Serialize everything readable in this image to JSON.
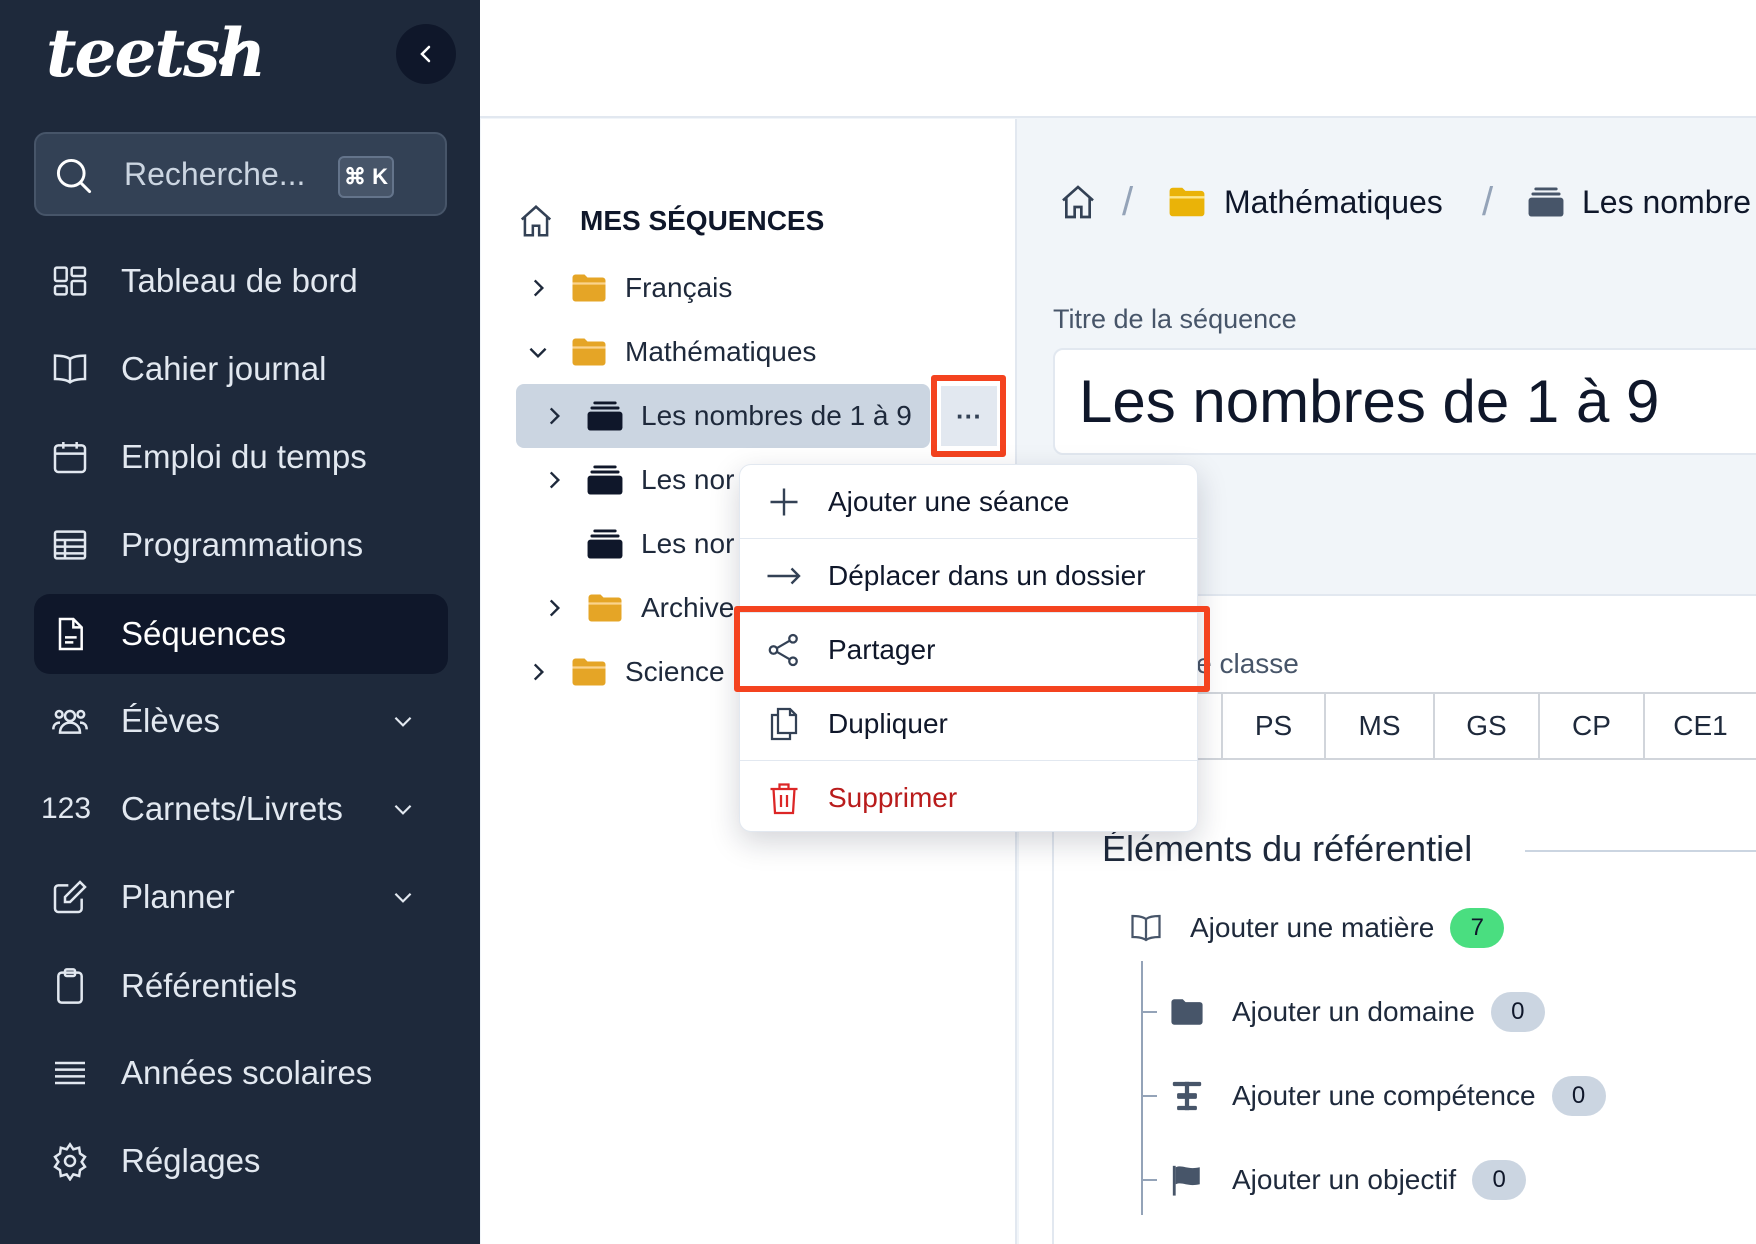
{
  "sidebar": {
    "logo": "teetsh",
    "search": {
      "placeholder": "Recherche...",
      "shortcut": "⌘ K"
    },
    "items": [
      {
        "label": "Tableau de bord",
        "icon": "dashboard-icon"
      },
      {
        "label": "Cahier journal",
        "icon": "book-icon"
      },
      {
        "label": "Emploi du temps",
        "icon": "calendar-icon"
      },
      {
        "label": "Programmations",
        "icon": "table-icon"
      },
      {
        "label": "Séquences",
        "icon": "document-icon",
        "active": true
      },
      {
        "label": "Élèves",
        "icon": "users-icon",
        "expandable": true
      },
      {
        "label": "Carnets/Livrets",
        "icon": "numbers-icon",
        "icon_text": "123",
        "expandable": true
      },
      {
        "label": "Planner",
        "icon": "pencil-icon",
        "expandable": true
      },
      {
        "label": "Référentiels",
        "icon": "clipboard-icon"
      },
      {
        "label": "Années scolaires",
        "icon": "list-icon"
      },
      {
        "label": "Réglages",
        "icon": "gear-icon"
      }
    ]
  },
  "tree": {
    "header": "MES SÉQUENCES",
    "items": [
      {
        "label": "Français",
        "type": "folder"
      },
      {
        "label": "Mathématiques",
        "type": "folder",
        "expanded": true
      },
      {
        "label": "Les nombres de 1 à 9",
        "type": "sequence",
        "selected": true
      },
      {
        "label": "Les nor",
        "type": "sequence"
      },
      {
        "label": "Les nor",
        "type": "sequence"
      },
      {
        "label": "Archive",
        "type": "folder"
      },
      {
        "label": "Science",
        "type": "folder"
      }
    ],
    "more_button": "···"
  },
  "context_menu": {
    "items": [
      {
        "label": "Ajouter une séance",
        "icon": "plus-icon"
      },
      {
        "label": "Déplacer dans un dossier",
        "icon": "arrow-right-icon"
      },
      {
        "label": "Partager",
        "icon": "share-icon",
        "highlighted": true
      },
      {
        "label": "Dupliquer",
        "icon": "copy-icon"
      },
      {
        "label": "Supprimer",
        "icon": "trash-icon",
        "danger": true
      }
    ]
  },
  "breadcrumb": {
    "items": [
      "Mathématiques",
      "Les nombre"
    ]
  },
  "form": {
    "title_label": "Titre de la séquence",
    "title_value": "Les nombres de 1 à 9",
    "levels_label": "Niveau(x) de classe",
    "levels": [
      "PS",
      "MS",
      "GS",
      "CP",
      "CE1"
    ]
  },
  "referentiel": {
    "title": "Éléments du référentiel",
    "matiere": {
      "label": "Ajouter une matière",
      "count": "7"
    },
    "children": [
      {
        "label": "Ajouter un domaine",
        "count": "0",
        "icon": "folder-icon"
      },
      {
        "label": "Ajouter une compétence",
        "count": "0",
        "icon": "competence-icon"
      },
      {
        "label": "Ajouter un objectif",
        "count": "0",
        "icon": "flag-icon"
      }
    ]
  },
  "colors": {
    "sidebar": "#1e293b",
    "accent_red": "#f4431f",
    "danger": "#b91c1c",
    "badge_green": "#4ade80",
    "badge_grey": "#cbd5e1",
    "folder": "#e5a526"
  }
}
